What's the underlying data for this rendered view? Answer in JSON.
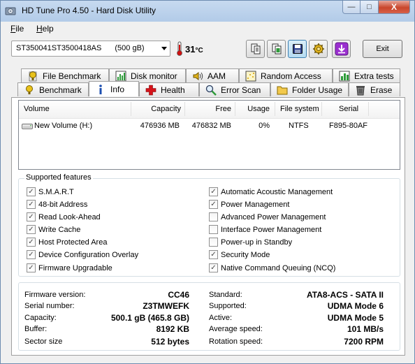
{
  "window": {
    "title": "HD Tune Pro 4.50 - Hard Disk Utility",
    "minimize_glyph": "—",
    "maximize_glyph": "□",
    "close_glyph": "X"
  },
  "menu": [
    {
      "label": "File",
      "accel": "F",
      "rest": "ile"
    },
    {
      "label": "Help",
      "accel": "H",
      "rest": "elp"
    }
  ],
  "toolbar": {
    "drive_name": "ST350041ST3500418AS",
    "drive_size": "(500 gB)",
    "temperature": "31",
    "temperature_unit": "°C",
    "buttons": [
      {
        "icon": "copy-text-icon"
      },
      {
        "icon": "copy-screenshot-icon"
      },
      {
        "icon": "save-icon"
      },
      {
        "icon": "options-icon"
      },
      {
        "icon": "download-icon"
      }
    ],
    "exit_label": "Exit"
  },
  "tabs_row1": [
    {
      "label": "File Benchmark",
      "icon": "file-benchmark-icon"
    },
    {
      "label": "Disk monitor",
      "icon": "disk-monitor-icon"
    },
    {
      "label": "AAM",
      "icon": "speaker-icon"
    },
    {
      "label": "Random Access",
      "icon": "random-access-icon"
    },
    {
      "label": "Extra tests",
      "icon": "extra-tests-icon"
    }
  ],
  "tabs_row2": [
    {
      "label": "Benchmark",
      "icon": "benchmark-icon"
    },
    {
      "label": "Info",
      "icon": "info-icon",
      "active": true
    },
    {
      "label": "Health",
      "icon": "health-cross-icon"
    },
    {
      "label": "Error Scan",
      "icon": "magnifier-icon"
    },
    {
      "label": "Folder Usage",
      "icon": "folder-icon"
    },
    {
      "label": "Erase",
      "icon": "trash-icon"
    }
  ],
  "volumes": {
    "columns": [
      "Volume",
      "Capacity",
      "Free",
      "Usage",
      "File system",
      "Serial"
    ],
    "rows": [
      {
        "volume": "New Volume (H:)",
        "capacity": "476936 MB",
        "free": "476832 MB",
        "usage": "0%",
        "file_system": "NTFS",
        "serial": "F895-80AF"
      }
    ]
  },
  "features": {
    "title": "Supported features",
    "left": [
      {
        "label": "S.M.A.R.T",
        "checked": true
      },
      {
        "label": "48-bit Address",
        "checked": true
      },
      {
        "label": "Read Look-Ahead",
        "checked": true
      },
      {
        "label": "Write Cache",
        "checked": true
      },
      {
        "label": "Host Protected Area",
        "checked": true
      },
      {
        "label": "Device Configuration Overlay",
        "checked": true
      },
      {
        "label": "Firmware Upgradable",
        "checked": true
      }
    ],
    "right": [
      {
        "label": "Automatic Acoustic Management",
        "checked": true
      },
      {
        "label": "Power Management",
        "checked": true
      },
      {
        "label": "Advanced Power Management",
        "checked": false
      },
      {
        "label": "Interface Power Management",
        "checked": false
      },
      {
        "label": "Power-up in Standby",
        "checked": false
      },
      {
        "label": "Security Mode",
        "checked": true
      },
      {
        "label": "Native Command Queuing (NCQ)",
        "checked": true
      }
    ]
  },
  "details": {
    "left": [
      {
        "label": "Firmware version:",
        "value": "CC46"
      },
      {
        "label": "Serial number:",
        "value": "Z3TMWEFK"
      },
      {
        "label": "Capacity:",
        "value": "500.1 gB (465.8 GB)"
      },
      {
        "label": "Buffer:",
        "value": "8192 KB"
      },
      {
        "label": "Sector size",
        "value": "512 bytes"
      }
    ],
    "right": [
      {
        "label": "Standard:",
        "value": "ATA8-ACS - SATA II"
      },
      {
        "label": "Supported:",
        "value": "UDMA Mode 6"
      },
      {
        "label": "Active:",
        "value": "UDMA Mode 5"
      },
      {
        "label": "Average speed:",
        "value": "101 MB/s"
      },
      {
        "label": "Rotation speed:",
        "value": "7200 RPM"
      }
    ]
  },
  "colors": {
    "titlebar": "#b9cfea",
    "close_button": "#c9462c",
    "accent_blue": "#3c7fb1"
  }
}
